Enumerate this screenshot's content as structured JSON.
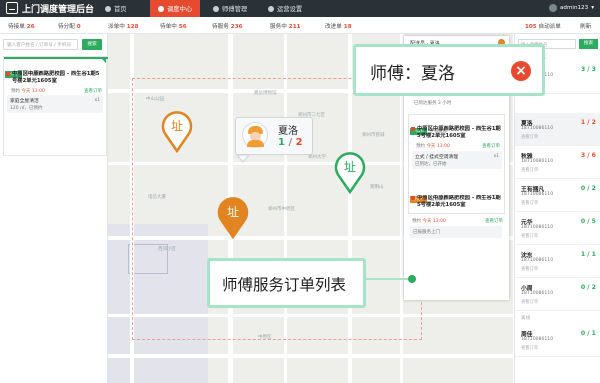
{
  "app": {
    "title": "上门调度管理后台",
    "user": "admin123"
  },
  "nav": [
    {
      "label": "首页"
    },
    {
      "label": "调度中心"
    },
    {
      "label": "师傅管理"
    },
    {
      "label": "运营设置"
    }
  ],
  "stats": [
    {
      "label": "待接单",
      "value": "26"
    },
    {
      "label": "待分配",
      "value": "0"
    },
    {
      "label": "派单中",
      "value": "128"
    },
    {
      "label": "待单中",
      "value": "56"
    },
    {
      "label": "待服务",
      "value": "236"
    },
    {
      "label": "服务中",
      "value": "211"
    },
    {
      "label": "改进单",
      "value": "18"
    }
  ],
  "auto_dispatch": {
    "count": "105",
    "label": "自动派单",
    "refresh": "刷新"
  },
  "left": {
    "search_placeholder": "输入客户姓名 / 订单号 / 手机号",
    "search_btn": "搜索",
    "tag": "一口价",
    "tag_type": "手机维修",
    "address": "中原区中原西路肥校园 - 西生谷1期5号楼2单元1605室",
    "time_label": "预约",
    "time": "今天 13:00",
    "detail_link": "查看订单",
    "item": "家庭全屋清洁",
    "item_meta": "120 ㎡，已预约",
    "qty": "x1"
  },
  "map": {
    "pin_label": "址",
    "labels": [
      "中山公园",
      "嵩岳博物馆",
      "郑州市二七区",
      "郑州市管城",
      "郑州大学",
      "郑州市中原区",
      "紫荆山",
      "电信大厦",
      "西郊小区",
      "碧沙岗",
      "中原区"
    ]
  },
  "master_popup": {
    "name": "夏洛",
    "done": "1",
    "total": "2"
  },
  "order_panel": {
    "header": "配送员 · 夏洛",
    "tag": "一口价",
    "tag_type": "手机维修",
    "tag2": "等待中",
    "tag2_type": "已预派单",
    "address": "中原区中原西路肥校园 - 西生谷1期5号楼2单元1605室",
    "time_label": "预约",
    "time": "今天 13:00",
    "link": "查看订单",
    "item1": "立式 / 挂式空调清理",
    "item1_meta": "已到达，已开始",
    "qty": "x1",
    "item2": "已报服务上门",
    "item2_meta": "已到达服务 3 小时"
  },
  "callout_master": {
    "text": "师傅：夏洛"
  },
  "callout_orders": {
    "text": "师傅服务订单列表"
  },
  "right": {
    "search_placeholder": "输入师傅姓名",
    "search_btn": "搜索",
    "header": "师傅服务情况",
    "rows": [
      {
        "name": "夏洛",
        "phone": "18710086110",
        "link": "查看订单",
        "count": "3 / 3"
      },
      {
        "name": "夏洛",
        "phone": "18710086110",
        "link": "查看订单",
        "count": "1 / 2"
      },
      {
        "name": "秋雅",
        "phone": "18710086110",
        "link": "查看订单",
        "count": "3 / 6"
      },
      {
        "name": "王有捆凡",
        "phone": "18710086110",
        "link": "查看订单",
        "count": "0 / 2"
      },
      {
        "name": "元华",
        "phone": "18710086110",
        "link": "查看订单",
        "count": "0 / 5"
      },
      {
        "name": "沈东",
        "phone": "18710086110",
        "link": "查看订单",
        "count": "1 / 1"
      },
      {
        "name": "小周",
        "phone": "18710086110",
        "link": "查看订单",
        "count": "0 / 2"
      },
      {
        "name": "周佳",
        "phone": "18710086110",
        "link": "查看订单",
        "count": "0 / 1"
      }
    ],
    "footer": "离线"
  },
  "colors": {
    "accent": "#e64b30",
    "green": "#2dab5f",
    "orange": "#e2841f",
    "callout_border": "#a6e3c9"
  }
}
